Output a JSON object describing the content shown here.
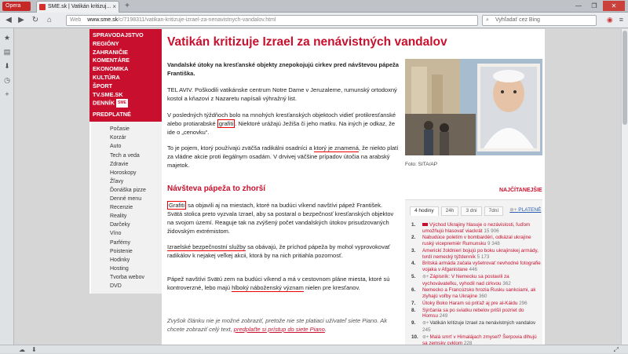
{
  "browser": {
    "menu_label": "Opera",
    "tab_title": "SME.sk | Vatikán kritizuj...",
    "tab_close": "×",
    "new_tab": "+",
    "url_label": "Web",
    "url_host": "www.sme.sk",
    "url_path": "/c/7198311/vatikan-kritizuje-izrael-za-nenavistnych-vandalov.html",
    "search_placeholder": "Vyhľadať cez Bing",
    "win_min": "—",
    "win_max": "❐",
    "win_close": "✕"
  },
  "site_nav": {
    "red_items": [
      "SPRAVODAJSTVO",
      "REGIÓNY",
      "ZAHRANIČIE",
      "KOMENTÁRE",
      "EKONOMIKA",
      "KULTÚRA",
      "ŠPORT",
      "TV.SME.SK",
      "DENNÍK"
    ],
    "badge": "SME",
    "predplatne": "PREDPLATNÉ",
    "grey_items": [
      "Počasie",
      "Korzár",
      "Auto",
      "Tech a veda",
      "Zdravie",
      "Horoskopy",
      "Žľavy",
      "Ďonáška pizze",
      "Denné menu",
      "Recenzie",
      "Reality",
      "Darčeky",
      "Víno",
      "Parfémy",
      "Poistenie",
      "Hodinky",
      "Hosting",
      "Tvorba webov",
      "DVD"
    ]
  },
  "article": {
    "headline": "Vatikán kritizuje Izrael za nenávistných vandalov",
    "perex": "Vandalské útoky na kresťanské objekty znepokojujú cirkev pred návštevou pápeža Františka.",
    "p1": "TEL AVIV. Poškodili vatikánske centrum Notre Dame v Jeruzaleme, rumunský ortodoxný kostol a kňazovi z Nazaretu napísali výhražný list.",
    "p2_a": "V posledných týždňoch bolo na mnohých kresťanských objektoch vidieť protikresťanské alebo protiarabské",
    "p2_hl": "grafiti",
    "p2_b": ". Niektoré urážajú Ježiša či jeho matku. Na iných je odkaz, že ide o „cenovku“.",
    "p3_a": "To je pojem, ktorý používajú zväčša radikálni osadníci a",
    "p3_hl": "ktorý je znamená",
    "p3_b": ", že niekto platí za vládne akcie proti ilegálnym osadám. V drvivej väčšine prípadov útočia na arabský majetok.",
    "subhead": "Návšteva pápeža to zhorší",
    "p4_hl": "Grafiti",
    "p4_b": " sa objavili aj na miestach, ktoré na budúci víkend navštívi pápež František. Svätá stolica preto vyzvala Izrael, aby sa postaral o bezpečnosť kresťanských objektov na svojom území. Reaguje tak na zvýšený počet vandalských útokov prisudzovaných židovským extrémistom.",
    "p5_hl": "Izraelské bezpečnostní služby",
    "p5_b": " sa obávajú, že príchod pápeža by mohol vyprovokovať radikálov k nejakej veľkej akcii, ktorá by na nich pritiahla pozornosť.",
    "p6_a": "Pápež navštívi Svätú zem na budúci víkend a má v cestovnom pláne miesta, ktoré sú kontroverzné, lebo majú",
    "p6_hl": "hlboký náboženský význam",
    "p6_b": " nielen pre kresťanov.",
    "paywall_a": "Zvyšok článku nie je možné zobraziť, pretože nie ste platiaci užívateľ siete Piano. Ak chcete zobraziť celý text,",
    "paywall_link": "predplaťte si prístup do siete Piano",
    "paywall_b": ".",
    "photo_caption": "Foto: SITA/AP"
  },
  "most_read": {
    "title": "NAJČÍTANEJŠIE",
    "tabs": [
      "4 hodiny",
      "24h",
      "3 dni",
      "7dní"
    ],
    "plat_label": "PLATENÉ",
    "items": [
      {
        "num": "1.",
        "text": "Východ Ukrajiny hlasuje o nezávislosti, ľuďom umožňujú hlasovať viackrát",
        "count": "15 906",
        "type": "video"
      },
      {
        "num": "2.",
        "text": "Nabudúce poletím v bombardéri, odkázal ukrajine ruský vicepremiér Rumunsku",
        "count": "9 348",
        "type": "plain"
      },
      {
        "num": "3.",
        "text": "Americkí žoldnieri bojujú po boku ukrajinskej armády, tvrdí nemecký týždenník",
        "count": "5 173",
        "type": "plain"
      },
      {
        "num": "4.",
        "text": "Britská armáda začala vyšetrovať nevhodné fotografie vojaka v Afganistane",
        "count": "446",
        "type": "plain"
      },
      {
        "num": "5.",
        "text": "Zápisník: V Nemecku sa postavili za vychovávateľku, vyhodil nad cirkvou",
        "count": "362",
        "type": "paid"
      },
      {
        "num": "6.",
        "text": "Nemecko a Francúzsko hrozia Rusku sankciami, ak zlyhajú voľby na Ukrajine",
        "count": "360",
        "type": "plain"
      },
      {
        "num": "7.",
        "text": "Útoky Boko Haram sú priťaž aj pre al-Káidu",
        "count": "296",
        "type": "plain"
      },
      {
        "num": "8.",
        "text": "Sýrčania sa po sviatku rebelov prišli pozriet do Homsu",
        "count": "249",
        "type": "plain"
      },
      {
        "num": "9.",
        "text": "Vatikán kritizuje Izrael za nenávistných vandalov",
        "count": "245",
        "type": "current"
      },
      {
        "num": "10.",
        "text": "Malá smrť v Himalájach zmysel? Šerpovia dlhujú sa zemsky cyklom",
        "count": "228",
        "type": "paid"
      }
    ]
  },
  "colors": {
    "brand_red": "#c8102e",
    "link_blue": "#2a5db0",
    "highlight": "#e00000"
  }
}
